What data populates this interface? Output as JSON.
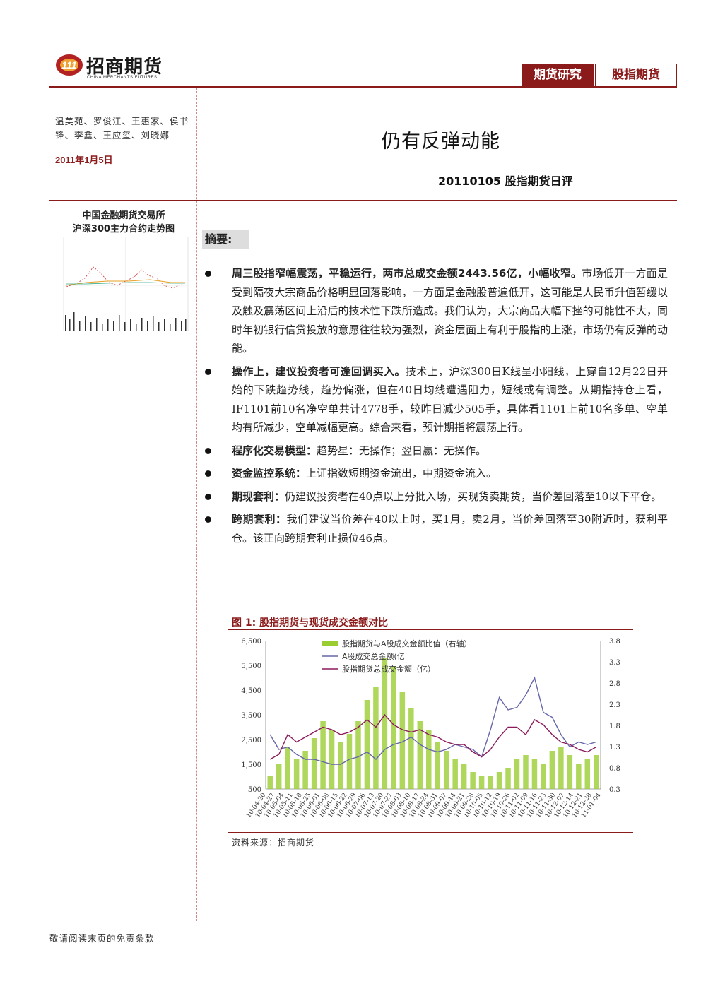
{
  "header": {
    "logo_cn": "招商期货",
    "logo_en": "CHINA MERCHANTS FUTURES",
    "tag_primary": "期货研究",
    "tag_secondary": "股指期货"
  },
  "authors": "温美苑、罗俊江、王惠家、侯书锋、李鑫、王应玺、刘晓娜",
  "date": "2011年1月5日",
  "title": "仍有反弹动能",
  "subtitle": "20110105 股指期货日评",
  "sidebar": {
    "title_line1": "中国金融期货交易所",
    "title_line2": "沪深300主力合约走势图"
  },
  "summary_label": "摘要:",
  "bullets": [
    {
      "lead": "周三股指窄幅震荡，平稳运行，两市总成交金额2443.56亿，小幅收窄。",
      "text": "市场低开一方面是受到隔夜大宗商品价格明显回落影响，一方面是金融股普遍低开，这可能是人民币升值暂缓以及触及震荡区间上沿后的技术性下跌所造成。我们认为，大宗商品大幅下挫的可能性不大，同时年初银行信贷投放的意愿往往较为强烈，资金层面上有利于股指的上涨，市场仍有反弹的动能。"
    },
    {
      "lead": "操作上，建议投资者可逢回调买入。",
      "text": "技术上，沪深300日K线呈小阳线，上穿自12月22日开始的下跌趋势线，趋势偏涨，但在40日均线遭遇阻力，短线或有调整。从期指持仓上看，IF1101前10名净空单共计4778手，较昨日减少505手，具体看1101上前10名多单、空单均有所减少，空单减幅更高。综合来看，预计期指将震荡上行。"
    },
    {
      "lead": "程序化交易模型：",
      "text": "趋势星：无操作；翌日赢：无操作。"
    },
    {
      "lead": "资金监控系统：",
      "text": "上证指数短期资金流出，中期资金流入。"
    },
    {
      "lead": "期现套利：",
      "text": "仍建议投资者在40点以上分批入场，买现货卖期货，当价差回落至10以下平仓。"
    },
    {
      "lead": "跨期套利：",
      "text": "我们建议当价差在40以上时，买1月，卖2月，当价差回落至30附近时，获利平仓。该正向跨期套利止损位46点。"
    }
  ],
  "figure_title": "图 1:  股指期货与现货成交金额对比",
  "source": "资料来源：招商期货",
  "footer": "敬请阅读末页的免责条款",
  "colors": {
    "brand": "#8b1a1a",
    "bar": "#9acd32",
    "line_a": "#6666aa",
    "line_f": "#8b1a5a"
  },
  "chart_data": {
    "type": "bar+line",
    "legend": [
      "股指期货与A股成交金额比值（右轴）",
      "A股成交总金额(亿",
      "股指期货总成交金额（亿）"
    ],
    "legend_position": "top-left",
    "y_left_ticks": [
      "6,500",
      "5,500",
      "4,500",
      "3,500",
      "2,500",
      "1,500",
      "500"
    ],
    "y_right_ticks": [
      "3.8",
      "3.3",
      "2.8",
      "2.3",
      "1.8",
      "1.3",
      "0.8",
      "0.3"
    ],
    "ylim_left": [
      500,
      6500
    ],
    "ylim_right": [
      0.3,
      3.8
    ],
    "x_ticks": [
      "10-04-20",
      "10-04-27",
      "10-05-04",
      "10-05-11",
      "10-05-18",
      "10-05-25",
      "10-06-01",
      "10-06-08",
      "10-06-15",
      "10-06-22",
      "10-06-29",
      "10-07-06",
      "10-07-13",
      "10-07-20",
      "10-07-27",
      "10-08-03",
      "10-08-10",
      "10-08-17",
      "10-08-24",
      "10-08-31",
      "10-09-07",
      "10-09-14",
      "10-09-21",
      "10-09-28",
      "10-10-05",
      "10-10-12",
      "10-10-19",
      "10-10-26",
      "10-11-02",
      "10-11-09",
      "10-11-16",
      "10-11-23",
      "10-11-30",
      "10-12-07",
      "10-12-14",
      "10-12-21",
      "10-12-28",
      "11-01-04"
    ],
    "ratio": [
      0.6,
      0.9,
      1.3,
      1.0,
      1.2,
      1.5,
      1.9,
      1.7,
      1.4,
      1.6,
      1.9,
      2.4,
      2.7,
      3.4,
      3.2,
      2.6,
      2.2,
      1.9,
      1.7,
      1.4,
      1.2,
      1.0,
      0.9,
      0.7,
      0.6,
      0.6,
      0.7,
      0.8,
      1.0,
      1.1,
      1.0,
      0.9,
      1.2,
      1.3,
      1.1,
      0.9,
      1.0,
      1.1
    ],
    "a_share": [
      2700,
      2100,
      2200,
      1900,
      1700,
      1700,
      1600,
      1500,
      1500,
      1700,
      1800,
      2000,
      1700,
      2100,
      2300,
      2400,
      2600,
      2300,
      2100,
      2000,
      2100,
      2300,
      2200,
      2100,
      1800,
      2900,
      4200,
      3700,
      3800,
      4300,
      5000,
      3600,
      3400,
      2700,
      2200,
      2400,
      2300,
      2400
    ],
    "futures": [
      1700,
      1900,
      2700,
      2400,
      2600,
      2800,
      3000,
      2900,
      2700,
      2800,
      3000,
      3300,
      3000,
      3500,
      3100,
      2900,
      2800,
      2900,
      2700,
      2600,
      2400,
      2300,
      2300,
      2000,
      1800,
      2100,
      2600,
      3000,
      3000,
      2700,
      3300,
      3100,
      2700,
      2400,
      2300,
      2100,
      2000,
      2200
    ]
  }
}
